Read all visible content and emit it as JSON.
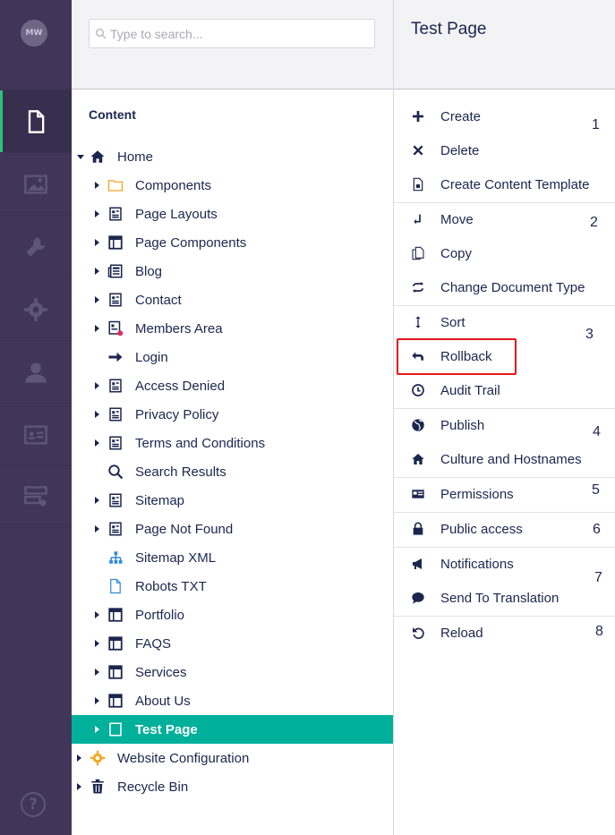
{
  "sidebar": {
    "avatar_initials": "MW",
    "items": [
      {
        "icon": "document-icon",
        "active": true
      },
      {
        "icon": "image-icon"
      },
      {
        "icon": "wrench-icon"
      },
      {
        "icon": "gear-icon"
      },
      {
        "icon": "user-icon"
      },
      {
        "icon": "id-card-icon"
      },
      {
        "icon": "forms-icon"
      }
    ],
    "help_symbol": "?"
  },
  "search": {
    "placeholder": "Type to search..."
  },
  "tree": {
    "heading": "Content",
    "nodes": [
      {
        "label": "Home",
        "level": 0,
        "caret": "down",
        "icon": "home-icon"
      },
      {
        "label": "Components",
        "level": 1,
        "caret": "right",
        "icon": "folder-icon"
      },
      {
        "label": "Page Layouts",
        "level": 1,
        "caret": "right",
        "icon": "page-icon"
      },
      {
        "label": "Page Components",
        "level": 1,
        "caret": "right",
        "icon": "layout-icon"
      },
      {
        "label": "Blog",
        "level": 1,
        "caret": "right",
        "icon": "newspaper-icon"
      },
      {
        "label": "Contact",
        "level": 1,
        "caret": "right",
        "icon": "page-icon"
      },
      {
        "label": "Members Area",
        "level": 1,
        "caret": "right",
        "icon": "page-protected-icon"
      },
      {
        "label": "Login",
        "level": 1,
        "caret": "none",
        "icon": "arrow-right-icon"
      },
      {
        "label": "Access Denied",
        "level": 1,
        "caret": "right",
        "icon": "page-icon"
      },
      {
        "label": "Privacy Policy",
        "level": 1,
        "caret": "right",
        "icon": "page-icon"
      },
      {
        "label": "Terms and Conditions",
        "level": 1,
        "caret": "right",
        "icon": "page-icon"
      },
      {
        "label": "Search Results",
        "level": 1,
        "caret": "none",
        "icon": "search-icon"
      },
      {
        "label": "Sitemap",
        "level": 1,
        "caret": "right",
        "icon": "page-icon"
      },
      {
        "label": "Page Not Found",
        "level": 1,
        "caret": "right",
        "icon": "page-icon"
      },
      {
        "label": "Sitemap XML",
        "level": 1,
        "caret": "none",
        "icon": "sitemap-icon"
      },
      {
        "label": "Robots TXT",
        "level": 1,
        "caret": "none",
        "icon": "blank-document-icon"
      },
      {
        "label": "Portfolio",
        "level": 1,
        "caret": "right",
        "icon": "layout-icon"
      },
      {
        "label": "FAQS",
        "level": 1,
        "caret": "right",
        "icon": "layout-icon"
      },
      {
        "label": "Services",
        "level": 1,
        "caret": "right",
        "icon": "layout-icon"
      },
      {
        "label": "About Us",
        "level": 1,
        "caret": "right",
        "icon": "layout-icon"
      },
      {
        "label": "Test Page",
        "level": 1,
        "caret": "right",
        "icon": "page-icon",
        "selected": true
      },
      {
        "label": "Website Configuration",
        "level": 0,
        "caret": "right",
        "icon": "gear-orange-icon"
      },
      {
        "label": "Recycle Bin",
        "level": 0,
        "caret": "right",
        "icon": "trash-icon"
      }
    ]
  },
  "actions": {
    "title": "Test Page",
    "items": [
      {
        "label": "Create",
        "icon": "plus-icon"
      },
      {
        "label": "Delete",
        "icon": "close-icon"
      },
      {
        "label": "Create Content Template",
        "icon": "template-icon"
      },
      {
        "label": "Move",
        "icon": "move-icon"
      },
      {
        "label": "Copy",
        "icon": "copy-icon"
      },
      {
        "label": "Change Document Type",
        "icon": "exchange-icon"
      },
      {
        "label": "Sort",
        "icon": "sort-icon"
      },
      {
        "label": "Rollback",
        "icon": "undo-icon",
        "highlighted": true
      },
      {
        "label": "Audit Trail",
        "icon": "clock-icon"
      },
      {
        "label": "Publish",
        "icon": "globe-icon"
      },
      {
        "label": "Culture and Hostnames",
        "icon": "home-icon"
      },
      {
        "label": "Permissions",
        "icon": "permissions-icon"
      },
      {
        "label": "Public access",
        "icon": "lock-icon"
      },
      {
        "label": "Notifications",
        "icon": "megaphone-icon"
      },
      {
        "label": "Send To Translation",
        "icon": "chat-icon"
      },
      {
        "label": "Reload",
        "icon": "reload-icon"
      }
    ],
    "group_numbers": [
      "1",
      "2",
      "3",
      "4",
      "5",
      "6",
      "7",
      "8"
    ]
  },
  "colors": {
    "sidebar_bg": "#413659",
    "selected_row": "#00b09b",
    "highlight_border": "#e5151d",
    "active_indicator": "#2bc37c"
  }
}
